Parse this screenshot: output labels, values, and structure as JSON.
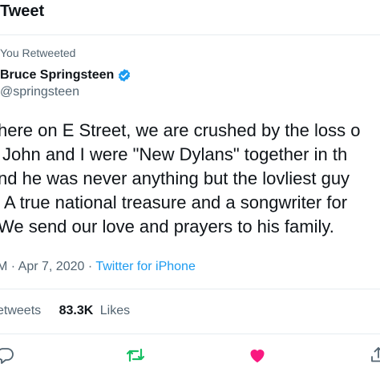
{
  "header": {
    "title": "Tweet"
  },
  "tweet": {
    "social_context": "You Retweeted",
    "author_name": "Bruce Springsteen",
    "author_handle": "@springsteen",
    "verified": true,
    "body_lines": [
      "here on E Street, we are crushed by the loss o",
      "John and I were \"New Dylans\" together in th",
      "nd he was never anything but the lovliest guy",
      "A true national treasure and a songwriter for",
      "We send our love and prayers to his family."
    ],
    "time_fragment": "M",
    "date": "Apr 7, 2020",
    "separator": "·",
    "source": "Twitter for iPhone",
    "retweets_label_fragment": "etweets",
    "likes_count": "83.3K",
    "likes_label": "Likes"
  },
  "actions": {
    "reply_icon": "reply-icon",
    "retweet_icon": "retweet-icon",
    "like_icon": "heart-icon",
    "share_icon": "share-icon"
  },
  "colors": {
    "accent": "#1d9bf0",
    "retweet_active": "#17bf63",
    "like_active": "#f91880",
    "secondary_text": "#536471",
    "divider": "#e6ecf0"
  }
}
